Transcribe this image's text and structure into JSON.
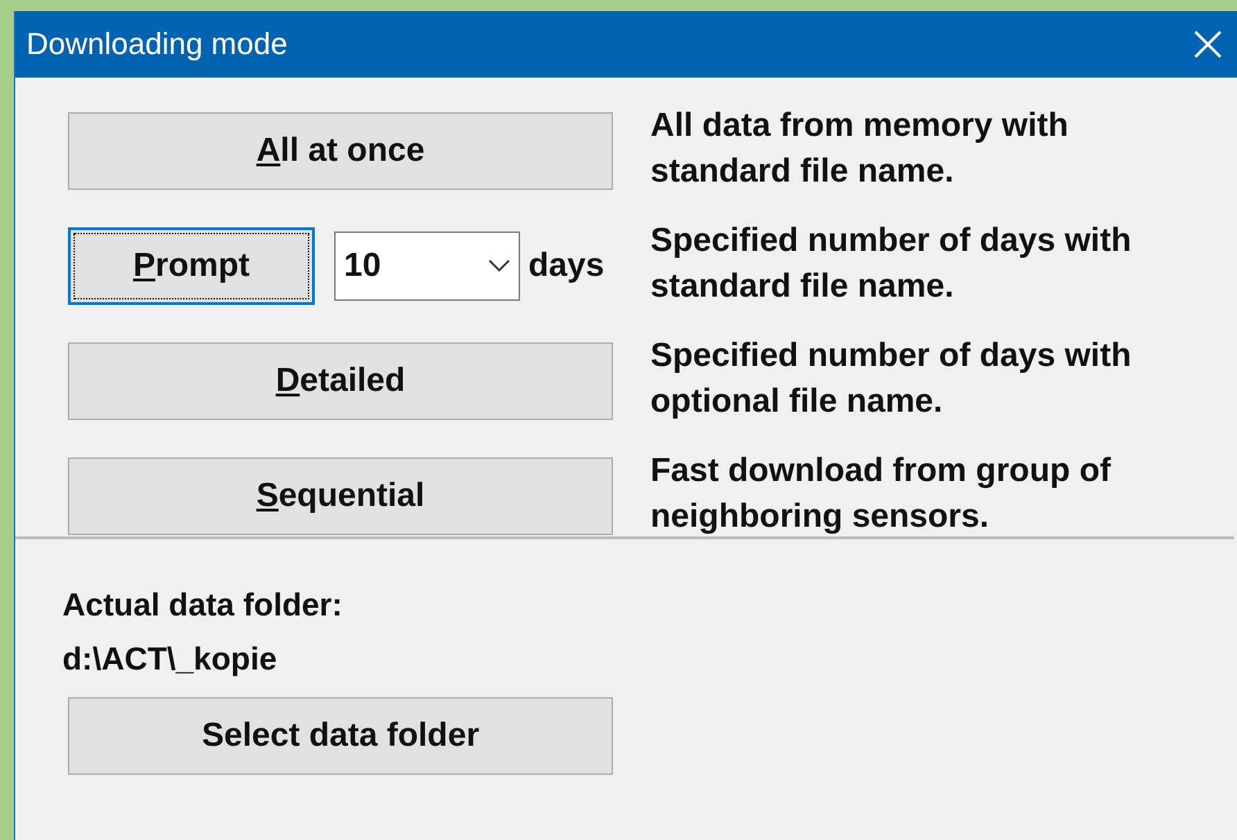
{
  "window": {
    "title": "Downloading mode"
  },
  "modes": [
    {
      "kind": "button",
      "label": "All at once",
      "mnemonic": true,
      "focused": false,
      "description": "All data from memory with standard file name."
    },
    {
      "kind": "prompt",
      "label": "Prompt",
      "mnemonic": true,
      "focused": true,
      "days_value": "10",
      "days_label": "days",
      "description": "Specified number of days with standard file name."
    },
    {
      "kind": "button",
      "label": "Detailed",
      "mnemonic": true,
      "focused": false,
      "description": "Specified number of days with optional file name."
    },
    {
      "kind": "button",
      "label": "Sequential",
      "mnemonic": true,
      "focused": false,
      "description": "Fast download from group of neighboring sensors."
    }
  ],
  "folder": {
    "label": "Actual data folder:",
    "path": "d:\\ACT\\_kopie",
    "button": "Select data folder"
  }
}
